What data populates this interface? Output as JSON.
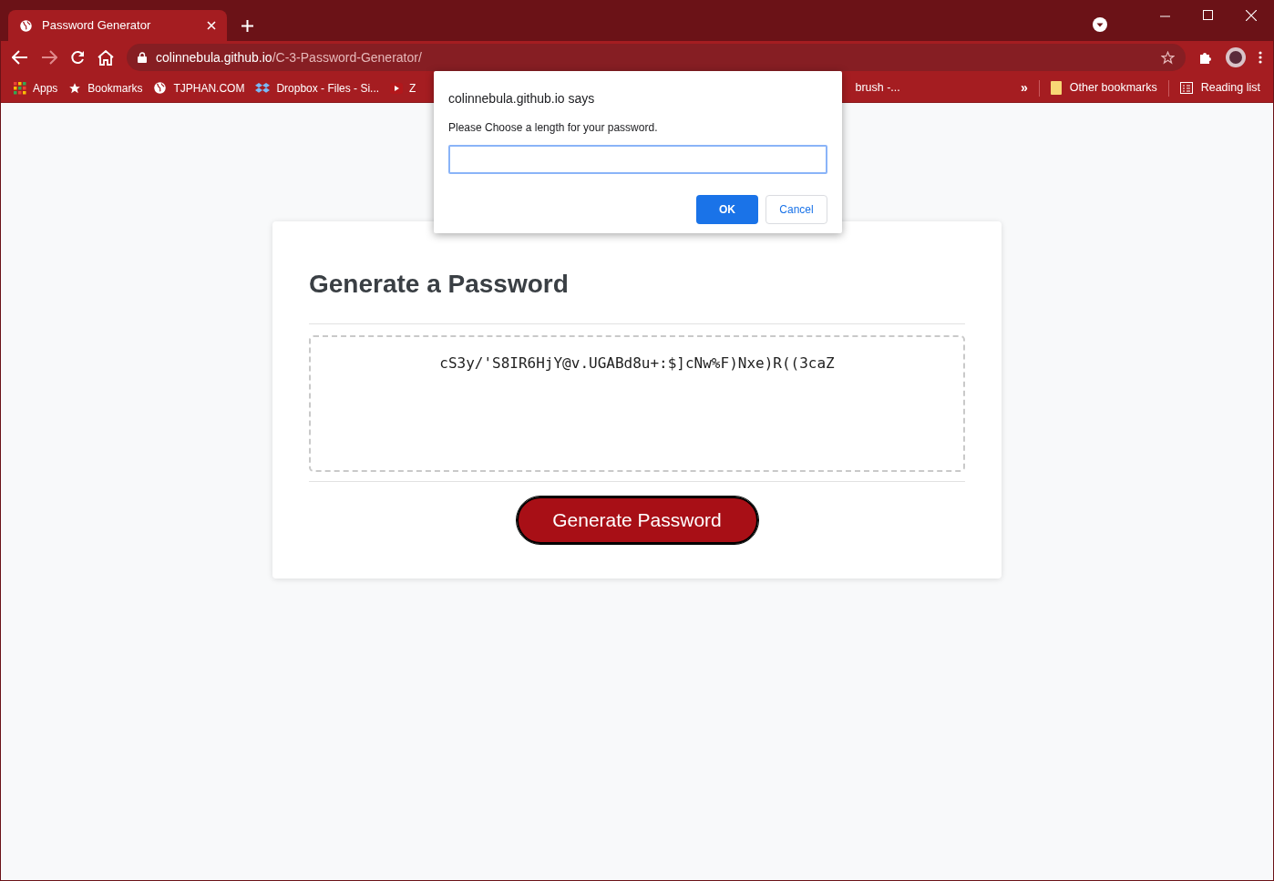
{
  "tab": {
    "title": "Password Generator",
    "selected": true
  },
  "address": {
    "domain": "colinnebula.github.io",
    "path": "/C-3-Password-Generator/"
  },
  "bookmarks": [
    {
      "kind": "apps",
      "label": "Apps"
    },
    {
      "kind": "star",
      "label": "Bookmarks"
    },
    {
      "kind": "globe",
      "label": "TJPHAN.COM"
    },
    {
      "kind": "dropbox",
      "label": "Dropbox - Files - Si..."
    },
    {
      "kind": "youtube",
      "label": "Z"
    }
  ],
  "bookmarks_after_dialog": {
    "label": "brush -..."
  },
  "overflow": "»",
  "other_bookmarks": "Other bookmarks",
  "reading_list": "Reading list",
  "card": {
    "heading": "Generate a Password",
    "password": "cS3y/'S8IR6HjY@v.UGABd8u+:$]cNw%F)Nxe)R((3caZ",
    "button": "Generate Password"
  },
  "dialog": {
    "title": "colinnebula.github.io says",
    "message": "Please Choose a length for your password.",
    "ok": "OK",
    "cancel": "Cancel"
  }
}
